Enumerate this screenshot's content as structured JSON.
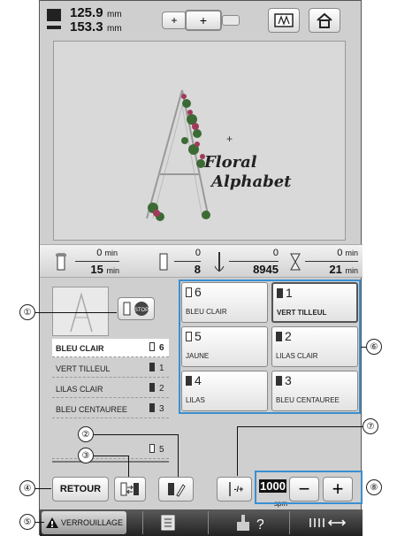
{
  "dimensions": {
    "width": "125.9",
    "height": "153.3",
    "unit": "mm"
  },
  "preview": {
    "line1": "Floral",
    "line2": "Alphabet"
  },
  "timing": {
    "color_time": "0",
    "color_time_unit": "min",
    "total_time": "15",
    "total_time_unit": "min",
    "color_index": "0",
    "color_count": "8",
    "stitch_current": "0",
    "stitch_total": "8945",
    "remaining_time": "0",
    "remaining_time_unit": "min",
    "remaining_total": "21",
    "remaining_total_unit": "min"
  },
  "color_list": [
    {
      "name": "BLEU CLAIR",
      "number": "6",
      "highlighted": true
    },
    {
      "name": "VERT TILLEUL",
      "number": "1"
    },
    {
      "name": "LILAS CLAIR",
      "number": "2"
    },
    {
      "name": "BLEU CENTAUREE",
      "number": "3"
    },
    {
      "name": "",
      "number": "5"
    }
  ],
  "color_grid": [
    {
      "number": "6",
      "name": "BLEU CLAIR",
      "outline": false
    },
    {
      "number": "1",
      "name": "VERT TILLEUL",
      "outline": false
    },
    {
      "number": "5",
      "name": "JAUNE",
      "outline": true
    },
    {
      "number": "2",
      "name": "LILAS CLAIR",
      "outline": false
    },
    {
      "number": "4",
      "name": "LILAS",
      "outline": false
    },
    {
      "number": "3",
      "name": "BLEU CENTAUREE",
      "outline": false
    }
  ],
  "buttons": {
    "retour": "RETOUR",
    "needle_minus_plus": "-/+",
    "minus": "−",
    "plus": "+",
    "verrouillage": "VERROUILLAGE"
  },
  "speed": {
    "value": "1000",
    "unit": "spm"
  },
  "callouts": [
    "①",
    "②",
    "③",
    "④",
    "⑤",
    "⑥",
    "⑦",
    "⑧"
  ]
}
